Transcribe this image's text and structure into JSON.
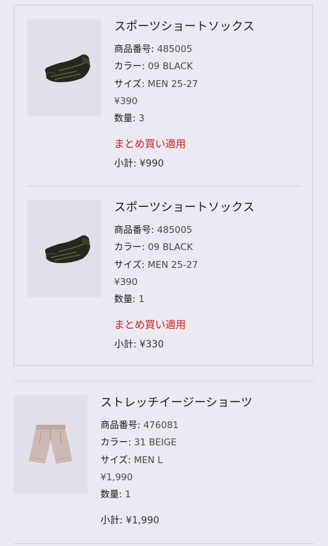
{
  "cart": {
    "items": [
      {
        "name": "スポーツショートソックス",
        "product_number_label": "商品番号",
        "product_number": "485005",
        "color_label": "カラー",
        "color": "09 BLACK",
        "size_label": "サイズ",
        "size": "MEN 25-27",
        "price": "¥390",
        "quantity_label": "数量",
        "quantity": "3",
        "promo": "まとめ買い適用",
        "subtotal_label": "小計",
        "subtotal": "¥990",
        "image_icon": "sock-icon"
      },
      {
        "name": "スポーツショートソックス",
        "product_number_label": "商品番号",
        "product_number": "485005",
        "color_label": "カラー",
        "color": "09 BLACK",
        "size_label": "サイズ",
        "size": "MEN 25-27",
        "price": "¥390",
        "quantity_label": "数量",
        "quantity": "1",
        "promo": "まとめ買い適用",
        "subtotal_label": "小計",
        "subtotal": "¥330",
        "image_icon": "sock-icon"
      },
      {
        "name": "ストレッチイージーショーツ",
        "product_number_label": "商品番号",
        "product_number": "476081",
        "color_label": "カラー",
        "color": "31 BEIGE",
        "size_label": "サイズ",
        "size": "MEN L",
        "price": "¥1,990",
        "quantity_label": "数量",
        "quantity": "1",
        "subtotal_label": "小計",
        "subtotal": "¥1,990",
        "image_icon": "shorts-icon"
      }
    ]
  }
}
